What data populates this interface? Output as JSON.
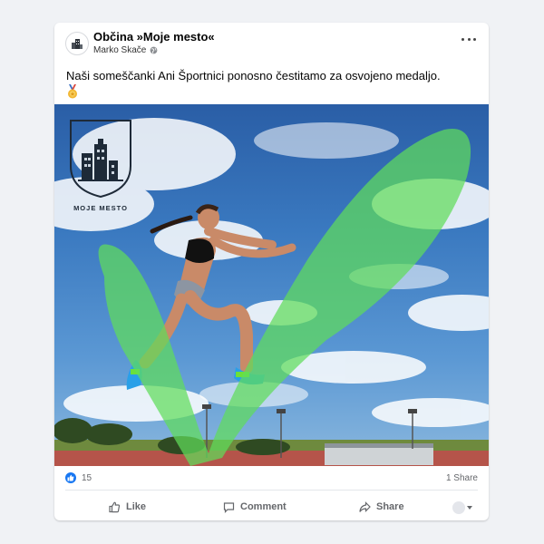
{
  "post": {
    "page_name": "Občina »Moje mesto«",
    "author": "Marko Skače",
    "audience_icon": "globe-icon",
    "text": "Naši someščanki Ani Športnici ponosno čestitamo za osvojeno medaljo.",
    "text_emoji": "medal-icon"
  },
  "image": {
    "logo_text": "MOJE MESTO",
    "overlay": "green-checkmark",
    "overlay_color": "#5fdc5a"
  },
  "stats": {
    "reaction_icon": "thumbs-up-icon",
    "reaction_count": "15",
    "shares": "1 Share"
  },
  "actions": {
    "like": "Like",
    "comment": "Comment",
    "share": "Share"
  },
  "colors": {
    "background": "#f0f2f5",
    "card": "#ffffff",
    "accent": "#1877f2",
    "muted_text": "#65676b"
  }
}
